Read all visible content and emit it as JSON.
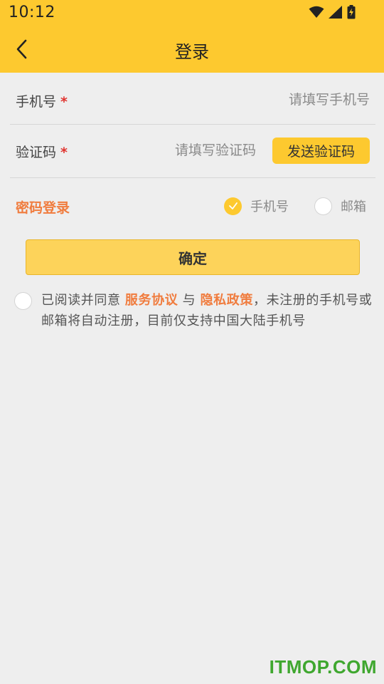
{
  "status_bar": {
    "time": "10:12",
    "icons": [
      "wifi-icon",
      "signal-icon",
      "battery-charging-icon"
    ]
  },
  "nav": {
    "back_icon": "chevron-left-icon",
    "title": "登录"
  },
  "form": {
    "phone": {
      "label": "手机号",
      "required_mark": "*",
      "placeholder": "请填写手机号",
      "value": ""
    },
    "code": {
      "label": "验证码",
      "required_mark": "*",
      "placeholder": "请填写验证码",
      "value": "",
      "send_button": "发送验证码"
    }
  },
  "login_mode": {
    "password_login": "密码登录",
    "options": [
      {
        "label": "手机号",
        "selected": true
      },
      {
        "label": "邮箱",
        "selected": false
      }
    ]
  },
  "confirm_button": "确定",
  "agreement": {
    "checked": false,
    "text_before": "已阅读并同意 ",
    "service_link": "服务协议",
    "text_and": " 与 ",
    "privacy_link": "隐私政策",
    "text_after": "，未注册的手机号或邮箱将自动注册，目前仅支持中国大陆手机号"
  },
  "watermark": "ITMOP.COM",
  "colors": {
    "accent": "#fdc92f",
    "link": "#f07c3e",
    "required": "#e0332e",
    "background": "#eeeeee"
  }
}
